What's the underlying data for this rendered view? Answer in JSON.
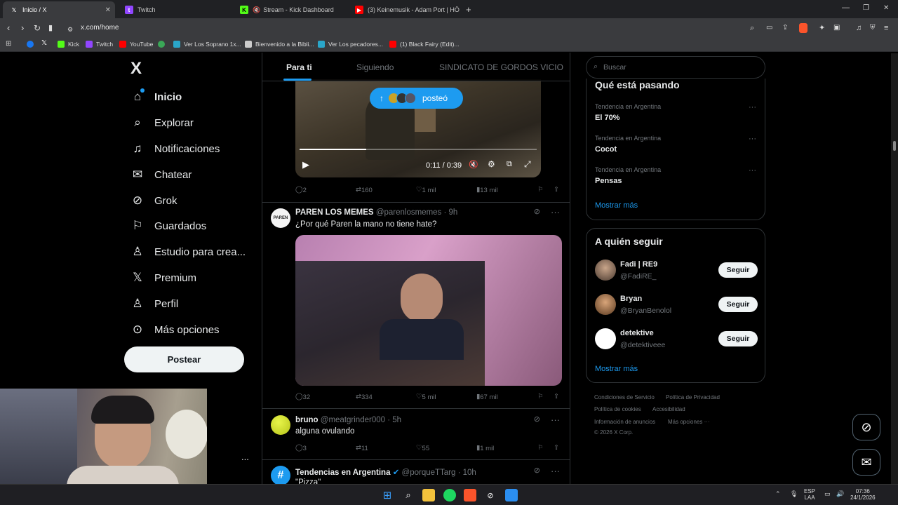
{
  "browser": {
    "tabs": [
      {
        "label": "Inicio / X",
        "favicon": "X",
        "active": true
      },
      {
        "label": "Twitch",
        "favicon": "twitch"
      },
      {
        "label": "Stream - Kick Dashboard",
        "favicon": "kick"
      },
      {
        "label": "(3) Keinemusik - Adam Port | HÖ",
        "favicon": "youtube"
      }
    ],
    "new_tab": "+",
    "url": "x.com/home",
    "bookmarks": [
      "Kick",
      "Twitch",
      "YouTube",
      "Ver Los Soprano 1x...",
      "Bienvenido a la Bibli...",
      "Ver Los pecadores...",
      "(1) Black Fairy (Edit)..."
    ]
  },
  "left_nav": {
    "logo": "X",
    "items": [
      {
        "label": "Inicio",
        "icon": "home-icon"
      },
      {
        "label": "Explorar",
        "icon": "search-icon"
      },
      {
        "label": "Notificaciones",
        "icon": "bell-icon"
      },
      {
        "label": "Chatear",
        "icon": "mail-icon"
      },
      {
        "label": "Grok",
        "icon": "grok-icon"
      },
      {
        "label": "Guardados",
        "icon": "bookmark-icon"
      },
      {
        "label": "Estudio para crea...",
        "icon": "studio-icon"
      },
      {
        "label": "Premium",
        "icon": "x-icon"
      },
      {
        "label": "Perfil",
        "icon": "person-icon"
      },
      {
        "label": "Más opciones",
        "icon": "more-icon"
      }
    ],
    "post_button": "Postear",
    "more": "..."
  },
  "feed": {
    "tabs": [
      "Para ti",
      "Siguiendo",
      "SINDICATO DE GORDOS VICIO"
    ],
    "posted_pill": "posteó",
    "video": {
      "time": "0:11 / 0:39",
      "progress": 0.28
    },
    "tweets": [
      {
        "actions": {
          "replies": "2",
          "reposts": "160",
          "likes": "1 mil",
          "views": "13 mil"
        }
      },
      {
        "name": "PAREN LOS MEMES",
        "handle": "@parenlosmemes · 9h",
        "text": "¿Por qué Paren la mano no tiene hate?",
        "actions": {
          "replies": "32",
          "reposts": "334",
          "likes": "5 mil",
          "views": "67 mil"
        }
      },
      {
        "name": "bruno",
        "handle": "@meatgrinder000 · 5h",
        "text": "alguna ovulando",
        "actions": {
          "replies": "3",
          "reposts": "11",
          "likes": "55",
          "views": "1 mil"
        }
      },
      {
        "name": "Tendencias en Argentina",
        "handle": "@porqueTTarg · 10h",
        "text": "\"Pizza\""
      }
    ]
  },
  "right": {
    "search_placeholder": "Buscar",
    "trends_title": "Qué está pasando",
    "trends": [
      {
        "category": "Tendencia en Argentina",
        "name": "El 70%"
      },
      {
        "category": "Tendencia en Argentina",
        "name": "Cocot"
      },
      {
        "category": "Tendencia en Argentina",
        "name": "Pensas"
      }
    ],
    "show_more": "Mostrar más",
    "who_to_follow_title": "A quién seguir",
    "follow": [
      {
        "name": "Fadi | RE9",
        "handle": "@FadiRE_"
      },
      {
        "name": "Bryan",
        "handle": "@BryanBenolol"
      },
      {
        "name": "detektive",
        "handle": "@detektiveee"
      }
    ],
    "follow_label": "Seguir",
    "footer": [
      "Condiciones de Servicio",
      "Política de Privacidad",
      "Política de cookies",
      "Accesibilidad",
      "Información de anuncios",
      "Más opciones ···",
      "© 2026 X Corp."
    ]
  },
  "taskbar": {
    "lang": "ESP",
    "lang2": "LAA",
    "time": "07:36",
    "date": "24/1/2026"
  },
  "colors": {
    "accent": "#1d9bf0",
    "background": "#000000",
    "border": "#2f3336"
  }
}
